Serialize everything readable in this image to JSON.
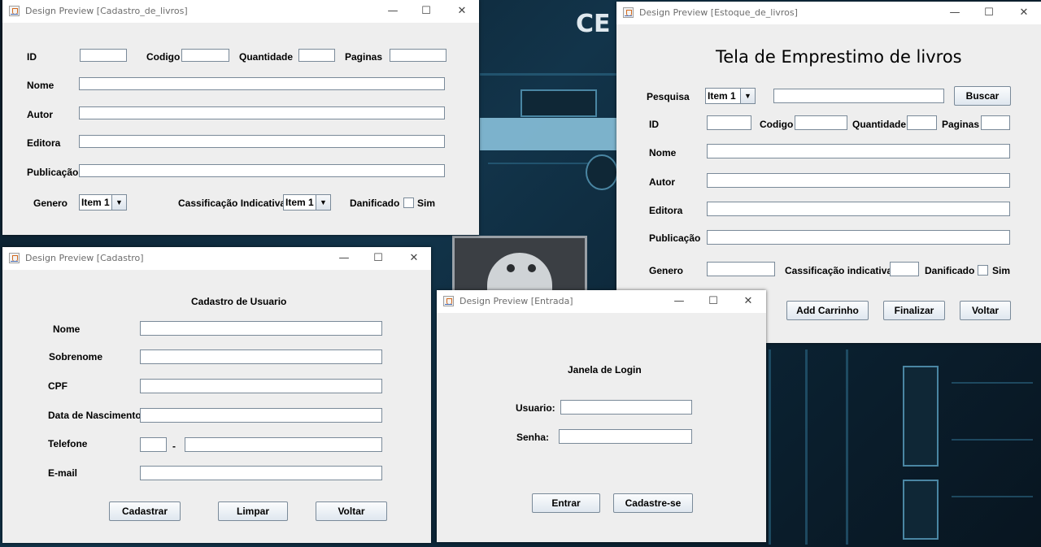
{
  "windows": {
    "cadastro_livros": {
      "title": "Design Preview [Cadastro_de_livros]",
      "labels": {
        "id": "ID",
        "codigo": "Codigo",
        "quantidade": "Quantidade",
        "paginas": "Paginas",
        "nome": "Nome",
        "autor": "Autor",
        "editora": "Editora",
        "publicacao": "Publicação",
        "genero": "Genero",
        "classificacao": "Cassificação Indicativa",
        "danificado": "Danificado",
        "sim": "Sim"
      },
      "genero_combo": "Item 1",
      "classificacao_combo": "Item 1"
    },
    "estoque_livros": {
      "title": "Design Preview [Estoque_de_livros]",
      "heading": "Tela de Emprestimo de livros",
      "labels": {
        "pesquisa": "Pesquisa",
        "id": "ID",
        "codigo": "Codigo",
        "quantidade": "Quantidade",
        "paginas": "Paginas",
        "nome": "Nome",
        "autor": "Autor",
        "editora": "Editora",
        "publicacao": "Publicação",
        "genero": "Genero",
        "classificacao": "Cassificação indicativa",
        "danificado": "Danificado",
        "sim": "Sim"
      },
      "pesquisa_combo": "Item 1",
      "buttons": {
        "buscar": "Buscar",
        "add_carrinho": "Add Carrinho",
        "finalizar": "Finalizar",
        "voltar": "Voltar"
      }
    },
    "cadastro": {
      "title": "Design Preview [Cadastro]",
      "heading": "Cadastro de Usuario",
      "labels": {
        "nome": "Nome",
        "sobrenome": "Sobrenome",
        "cpf": "CPF",
        "nascimento": "Data de Nascimento",
        "telefone": "Telefone",
        "email": "E-mail",
        "dash": "-"
      },
      "buttons": {
        "cadastrar": "Cadastrar",
        "limpar": "Limpar",
        "voltar": "Voltar"
      }
    },
    "entrada": {
      "title": "Design Preview [Entrada]",
      "heading": "Janela de Login",
      "labels": {
        "usuario": "Usuario:",
        "senha": "Senha:"
      },
      "buttons": {
        "entrar": "Entrar",
        "cadastrese": "Cadastre-se"
      }
    }
  },
  "window_controls": {
    "minimize": "—",
    "maximize": "☐",
    "close": "✕"
  },
  "desktop": {
    "fragment_text": "CE"
  }
}
